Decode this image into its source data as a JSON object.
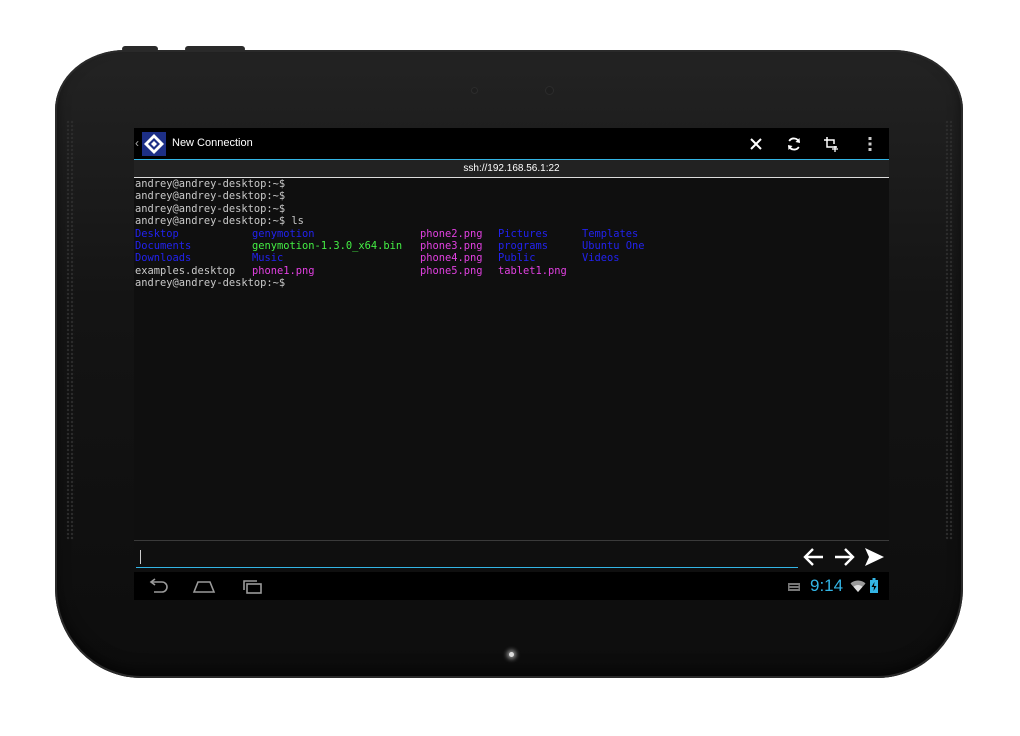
{
  "app": {
    "title": "New Connection",
    "url": "ssh://192.168.56.1:22",
    "actions": [
      "close-icon",
      "refresh-icon",
      "crop-add-icon",
      "overflow-menu-icon"
    ]
  },
  "terminal": {
    "lines": [
      "andrey@andrey-desktop:~$",
      "andrey@andrey-desktop:~$",
      "andrey@andrey-desktop:~$",
      "andrey@andrey-desktop:~$ ls"
    ],
    "ls_rows": [
      [
        {
          "text": "Desktop",
          "color": "#2222ee"
        },
        {
          "text": "genymotion",
          "color": "#2222ee"
        },
        {
          "text": "phone2.png",
          "color": "#e040e0"
        },
        {
          "text": "Pictures",
          "color": "#2222ee"
        },
        {
          "text": "Templates",
          "color": "#2222ee"
        }
      ],
      [
        {
          "text": "Documents",
          "color": "#2222ee"
        },
        {
          "text": "genymotion-1.3.0_x64.bin",
          "color": "#44ee44"
        },
        {
          "text": "phone3.png",
          "color": "#e040e0"
        },
        {
          "text": "programs",
          "color": "#2222ee"
        },
        {
          "text": "Ubuntu One",
          "color": "#2222ee"
        }
      ],
      [
        {
          "text": "Downloads",
          "color": "#2222ee"
        },
        {
          "text": "Music",
          "color": "#2222ee"
        },
        {
          "text": "phone4.png",
          "color": "#e040e0"
        },
        {
          "text": "Public",
          "color": "#2222ee"
        },
        {
          "text": "Videos",
          "color": "#2222ee"
        }
      ],
      [
        {
          "text": "examples.desktop",
          "color": "#c9c9c9"
        },
        {
          "text": "phone1.png",
          "color": "#e040e0"
        },
        {
          "text": "phone5.png",
          "color": "#e040e0"
        },
        {
          "text": "tablet1.png",
          "color": "#e040e0"
        },
        {
          "text": "",
          "color": "#c9c9c9"
        }
      ]
    ],
    "last_prompt": "andrey@andrey-desktop:~$"
  },
  "input": {
    "value": "",
    "placeholder": ""
  },
  "controls": [
    "arrow-left-icon",
    "arrow-right-icon",
    "send-icon"
  ],
  "navbar": {
    "icons": [
      "back-icon",
      "home-icon",
      "recents-icon"
    ],
    "time": "9:14"
  },
  "colors": {
    "accent": "#33b5e5",
    "dir": "#2222ee",
    "exec": "#44ee44",
    "image": "#e040e0",
    "text": "#c9c9c9"
  }
}
